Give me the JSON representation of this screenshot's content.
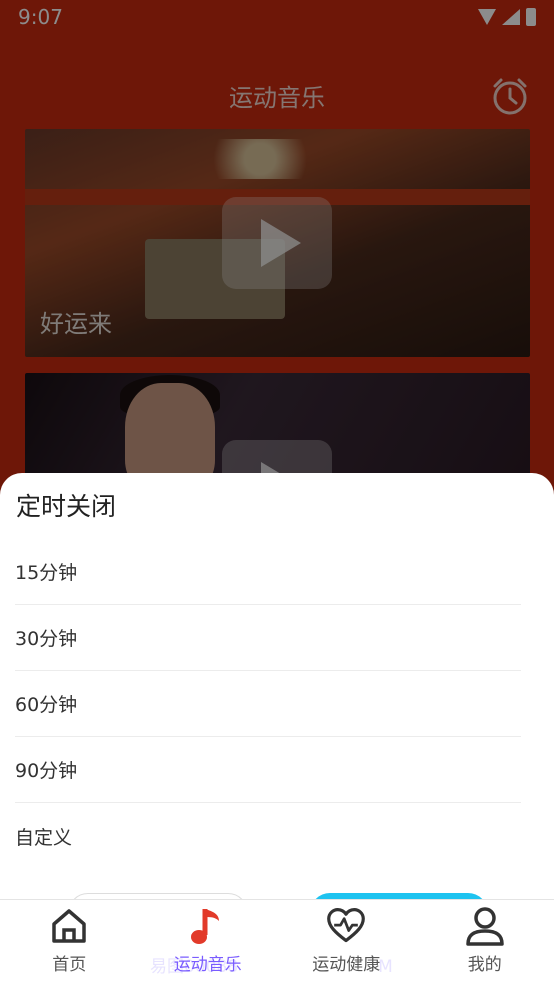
{
  "status_bar": {
    "time": "9:07"
  },
  "header": {
    "title": "运动音乐",
    "alarm_icon": "alarm-clock-icon"
  },
  "cards": [
    {
      "title": "好运来"
    },
    {
      "title": ""
    }
  ],
  "sheet": {
    "title": "定时关闭",
    "options": [
      "15分钟",
      "30分钟",
      "60分钟",
      "90分钟",
      "自定义"
    ]
  },
  "watermark": "易图00088",
  "watermark_suffix": "M",
  "bottom_nav": {
    "items": [
      {
        "label": "首页",
        "icon": "home-icon"
      },
      {
        "label": "运动音乐",
        "icon": "music-note-icon",
        "active": true
      },
      {
        "label": "运动健康",
        "icon": "heart-pulse-icon"
      },
      {
        "label": "我的",
        "icon": "user-icon"
      }
    ]
  },
  "colors": {
    "header_bg": "#c92a10",
    "accent": "#1ec3f0",
    "active_nav": "#7a5cff",
    "music_icon": "#e23a2a"
  }
}
